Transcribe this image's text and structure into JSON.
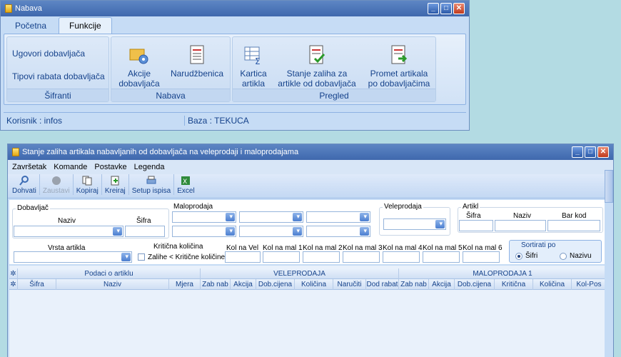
{
  "top_window": {
    "title": "Nabava",
    "tabs": [
      "Početna",
      "Funkcije"
    ],
    "groups": {
      "sifranti": {
        "label": "Šifranti",
        "items": [
          "Ugovori dobavljača",
          "Tipovi rabata dobavljača"
        ]
      },
      "nabava": {
        "label": "Nabava",
        "akcije": "Akcije dobavljača",
        "narudzbenica": "Narudžbenica"
      },
      "pregled": {
        "label": "Pregled",
        "kartica": "Kartica artikla",
        "stanje": "Stanje zaliha za artikle od dobavljača",
        "promet": "Promet artikala po dobavljačima"
      }
    },
    "status": {
      "user": "Korisnik : infos",
      "db": "Baza : TEKUCA"
    }
  },
  "main_window": {
    "title": "Stanje zaliha artikala nabavljanih od dobavljača na veleprodaji i maloprodajama",
    "menu": [
      "Završetak",
      "Komande",
      "Postavke",
      "Legenda"
    ],
    "toolbar": {
      "dohvati": "Dohvati",
      "zaustavi": "Zaustavi",
      "kopiraj": "Kopiraj",
      "kreiraj": "Kreiraj",
      "setup": "Setup ispisa",
      "excel": "Excel"
    },
    "filters": {
      "dobavljac": {
        "legend": "Dobavljač",
        "naziv": "Naziv",
        "sifra": "Šifra"
      },
      "maloprodaja": {
        "legend": "Maloprodaja"
      },
      "veleprodaja": {
        "legend": "Veleprodaja"
      },
      "artikl": {
        "legend": "Artikl",
        "sifra": "Šifra",
        "naziv": "Naziv",
        "bar_kod": "Bar kod"
      },
      "vrsta_artikla": "Vrsta artikla",
      "kriticna_kolicina": "Kritična količina",
      "zalihe_label": "Zalihe < Kritične količine",
      "kol_labels": [
        "Kol na Vel",
        "Kol na mal 1",
        "Kol na mal 2",
        "Kol na mal 3",
        "Kol na mal 4",
        "Kol na mal 5",
        "Kol na mal 6"
      ],
      "sort": {
        "legend": "Sortirati po",
        "opt1": "Šifri",
        "opt2": "Nazivu"
      }
    },
    "grid": {
      "bands": [
        "Podaci o artiklu",
        "VELEPRODAJA",
        "MALOPRODAJA 1"
      ],
      "columns": [
        "Šifra",
        "Naziv",
        "Mjera",
        "Zab nab",
        "Akcija",
        "Dob.cijena",
        "Količina",
        "Naručiti",
        "Dod rabat",
        "Zab nab",
        "Akcija",
        "Dob.cijena",
        "Kritična",
        "Količina",
        "Kol-Pos"
      ]
    }
  }
}
